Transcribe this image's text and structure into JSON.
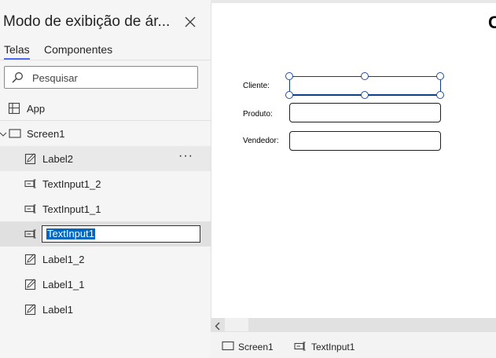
{
  "panel": {
    "title": "Modo de exibição de ár...",
    "tabs": [
      {
        "label": "Telas",
        "active": true
      },
      {
        "label": "Componentes",
        "active": false
      }
    ],
    "search": {
      "placeholder": "Pesquisar",
      "value": ""
    },
    "app_label": "App",
    "tree": [
      {
        "label": "Screen1",
        "icon": "screen-icon"
      },
      {
        "label": "Label2",
        "icon": "label-edit-icon",
        "more": "···"
      },
      {
        "label": "TextInput1_2",
        "icon": "text-input-icon"
      },
      {
        "label": "TextInput1_1",
        "icon": "text-input-icon"
      },
      {
        "label": "TextInput1",
        "icon": "text-input-icon",
        "editing": true
      },
      {
        "label": "Label1_2",
        "icon": "label-edit-icon"
      },
      {
        "label": "Label1_1",
        "icon": "label-edit-icon"
      },
      {
        "label": "Label1",
        "icon": "label-edit-icon"
      }
    ]
  },
  "canvas": {
    "heading_fragment": "C",
    "fields": [
      {
        "label": "Cliente:",
        "value": ""
      },
      {
        "label": "Produto:",
        "value": ""
      },
      {
        "label": "Vendedor:",
        "value": ""
      }
    ]
  },
  "breadcrumb": [
    {
      "label": "Screen1",
      "icon": "screen-icon"
    },
    {
      "label": "TextInput1",
      "icon": "text-input-icon"
    }
  ],
  "colors": {
    "accent": "#4f6bed",
    "selection": "#0067c0",
    "selected_border": "#0f3d8a"
  }
}
